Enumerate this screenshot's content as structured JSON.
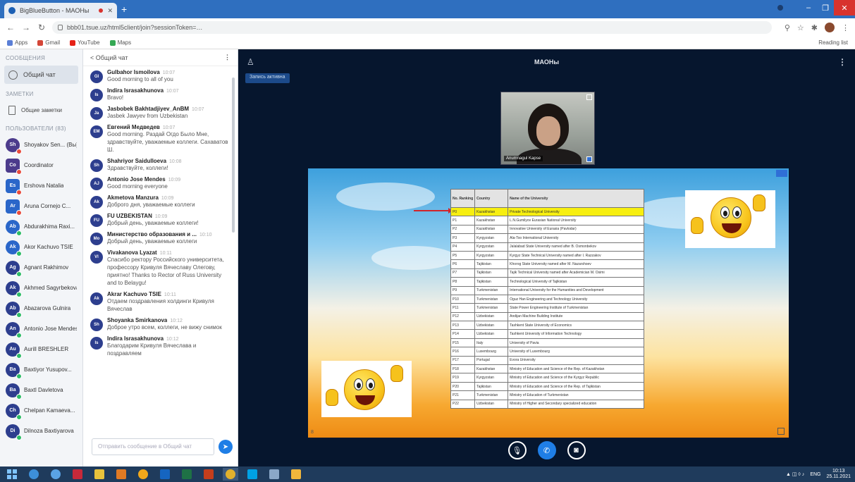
{
  "browser": {
    "tab_title": "BigBlueButton - МАОНы",
    "url": "bbb01.tsue.uz/html5client/join?sessionToken=…",
    "bookmarks": [
      "Apps",
      "Gmail",
      "YouTube",
      "Maps"
    ],
    "reading_list": "Reading list"
  },
  "userpanel": {
    "messages_section": "Сообщения",
    "public_chat": "Общий чат",
    "notes_section": "Заметки",
    "shared_notes": "Общие заметки",
    "users_section": "Пользователи (83)",
    "users": [
      {
        "initials": "Sh",
        "name": "Shoyakov Sen... (Вы)",
        "color": "#4c3b8c",
        "dot": "#e84b3c",
        "square": false
      },
      {
        "initials": "Co",
        "name": "Coordinator",
        "color": "#4c3b8c",
        "dot": "#e84b3c",
        "square": true
      },
      {
        "initials": "Es",
        "name": "Ershova Natalia",
        "color": "#2a66c9",
        "dot": "#e84b3c",
        "square": true
      },
      {
        "initials": "Ar",
        "name": "Aruna Cornejo C...",
        "color": "#2a66c9",
        "dot": "#e84b3c",
        "square": true
      },
      {
        "initials": "Ab",
        "name": "Abdurakhima Raxi...",
        "color": "#2a66c9",
        "dot": "#2dbb66",
        "square": false
      },
      {
        "initials": "Ak",
        "name": "Akor Kachuvo TSIE",
        "color": "#2a66c9",
        "dot": "#2dbb66",
        "square": false
      },
      {
        "initials": "Ag",
        "name": "Agnant Rakhimov",
        "color": "#2d3e8e",
        "dot": "#2dbb66",
        "square": false
      },
      {
        "initials": "Ak",
        "name": "Akhmed Sagyrbekova",
        "color": "#2d3e8e",
        "dot": "#2dbb66",
        "square": false
      },
      {
        "initials": "Ab",
        "name": "Abazarova Gulnira",
        "color": "#2d3e8e",
        "dot": "#2dbb66",
        "square": false
      },
      {
        "initials": "An",
        "name": "Antonio Jose Mendes",
        "color": "#2d3e8e",
        "dot": "#2dbb66",
        "square": false
      },
      {
        "initials": "Au",
        "name": "Aurill BRESHLER",
        "color": "#2d3e8e",
        "dot": "#2dbb66",
        "square": false
      },
      {
        "initials": "Ba",
        "name": "Baxtiyor Yusupov...",
        "color": "#2d3e8e",
        "dot": "#2dbb66",
        "square": false
      },
      {
        "initials": "Ba",
        "name": "Baxtl Davletova",
        "color": "#2d3e8e",
        "dot": "#2dbb66",
        "square": false
      },
      {
        "initials": "Ch",
        "name": "Chelpan Kamaeva...",
        "color": "#2d3e8e",
        "dot": "#2dbb66",
        "square": false
      },
      {
        "initials": "Di",
        "name": "Dilnoza Baxtiyarova",
        "color": "#2d3e8e",
        "dot": "#2dbb66",
        "square": false
      }
    ]
  },
  "chat": {
    "title": "< Общий чат",
    "placeholder": "Отправить сообщение в Общий чат",
    "messages": [
      {
        "initials": "GI",
        "name": "Gulbahor Ismoilova",
        "time": "10:07",
        "text": "Good morning to all of you"
      },
      {
        "initials": "Is",
        "name": "Indira Israsakhunova",
        "time": "10:07",
        "text": "Bravo!"
      },
      {
        "initials": "Ja",
        "name": "Jasbobek Bakhtadjiyev_AnBM",
        "time": "10:07",
        "text": "Jasbek Jawyev from Uzbekistan"
      },
      {
        "initials": "ЕМ",
        "name": "Евгений Медведев",
        "time": "10:07",
        "text": "Good morning. Раздай Огдо Было Мне, здравствуйте, уважаемые коллеги. Сахаватов Ш."
      },
      {
        "initials": "Sh",
        "name": "Shahriyor Saidulloeva",
        "time": "10:08",
        "text": "Здравствуйте, коллеги!"
      },
      {
        "initials": "AJ",
        "name": "Antonio Jose Mendes",
        "time": "10:09",
        "text": "Good morning everyone"
      },
      {
        "initials": "Ak",
        "name": "Akmetova Manzura",
        "time": "10:09",
        "text": "Доброго дня, уважаемые коллеги"
      },
      {
        "initials": "FU",
        "name": "FU UZBEKISTAN",
        "time": "10:09",
        "text": "Добрый день, уважаемые коллеги!"
      },
      {
        "initials": "Мо",
        "name": "Министерство образования и ...",
        "time": "10:10",
        "text": "Добрый день, уважаемые коллеги"
      },
      {
        "initials": "Vl",
        "name": "Vivakanova Lyazat",
        "time": "10:11",
        "text": "Спасибо ректору Российского университета, профессору Кривуля Вячеславу Олегову, приятно! Thanks to Rector of Russ University and to Belaygu!"
      },
      {
        "initials": "Ak",
        "name": "Akrar Kachuvo TSIE",
        "time": "10:11",
        "text": "Отдаем поздравления холдинги Кривуля Вячеслав"
      },
      {
        "initials": "Sh",
        "name": "Shoyanka Smirkanova",
        "time": "10:12",
        "text": "Доброе утро всем, коллеги, не вижу снимок"
      },
      {
        "initials": "Is",
        "name": "Indira Israsakhunova",
        "time": "10:12",
        "text": "Благодарим Кривуля Вячеслава и поздравляем"
      }
    ]
  },
  "meeting": {
    "title": "МАОНы",
    "recording_label": "Запись активна",
    "webcam_caption": "Anumnagul Kapse",
    "slide_page": "8"
  },
  "table": {
    "headers": [
      "No. Ranking",
      "Country",
      "Name of the University"
    ],
    "rows": [
      [
        "P0",
        "Kazakhstan",
        "Private Technological University"
      ],
      [
        "P1",
        "Kazakhstan",
        "L.N.Gumilyov Eurasian National University"
      ],
      [
        "P2",
        "Kazakhstan",
        "Innovative University of Eurasia (Pavlodar)"
      ],
      [
        "P3",
        "Kyrgyzstan",
        "Ala-Too International University"
      ],
      [
        "P4",
        "Kyrgyzstan",
        "Jalalabad State University named after B. Osmonbekov"
      ],
      [
        "P5",
        "Kyrgyzstan",
        "Kyrgyz State Technical University named after I. Razzakov"
      ],
      [
        "P6",
        "Tajikistan",
        "Khorog State University named after M. Nazarshoev"
      ],
      [
        "P7",
        "Tajikistan",
        "Tajik Technical University named after Academician M. Osimi"
      ],
      [
        "P8",
        "Tajikistan",
        "Technological University of Tajikistan"
      ],
      [
        "P9",
        "Turkmenistan",
        "International University for the Humanities and Development"
      ],
      [
        "P10",
        "Turkmenistan",
        "Oguz Han Engineering and Technology University"
      ],
      [
        "P11",
        "Turkmenistan",
        "State Power Engineering Institute of Turkmenistan"
      ],
      [
        "P12",
        "Uzbekistan",
        "Andijan Machine Building Institute"
      ],
      [
        "P13",
        "Uzbekistan",
        "Tashkent State University of Economics"
      ],
      [
        "P14",
        "Uzbekistan",
        "Tashkent University of Information Technology"
      ],
      [
        "P15",
        "Italy",
        "University of Pavia"
      ],
      [
        "P16",
        "Luxembourg",
        "University of Luxembourg"
      ],
      [
        "P17",
        "Portugal",
        "Evora University"
      ],
      [
        "P18",
        "Kazakhstan",
        "Ministry of Education and Science of the Rep. of Kazakhstan"
      ],
      [
        "P19",
        "Kyrgyzstan",
        "Ministry of Education and Science of the Kyrgyz Republic"
      ],
      [
        "P20",
        "Tajikistan",
        "Ministry of Education and Science of the Rep. of Tajikistan"
      ],
      [
        "P21",
        "Turkmenistan",
        "Ministry of Education of Turkmenistan"
      ],
      [
        "P22",
        "Uzbekistan",
        "Ministry of Higher and Secondary specialized education"
      ]
    ],
    "highlight_row": 0,
    "highlight_color": "#f7ef10"
  },
  "taskbar": {
    "lang": "ENG",
    "time": "10:13",
    "date": "25.11.2021"
  },
  "colors": {
    "accent": "#1f7ee6",
    "meeting_bg": "#06162e",
    "browser_bar": "#2f6fbf"
  }
}
